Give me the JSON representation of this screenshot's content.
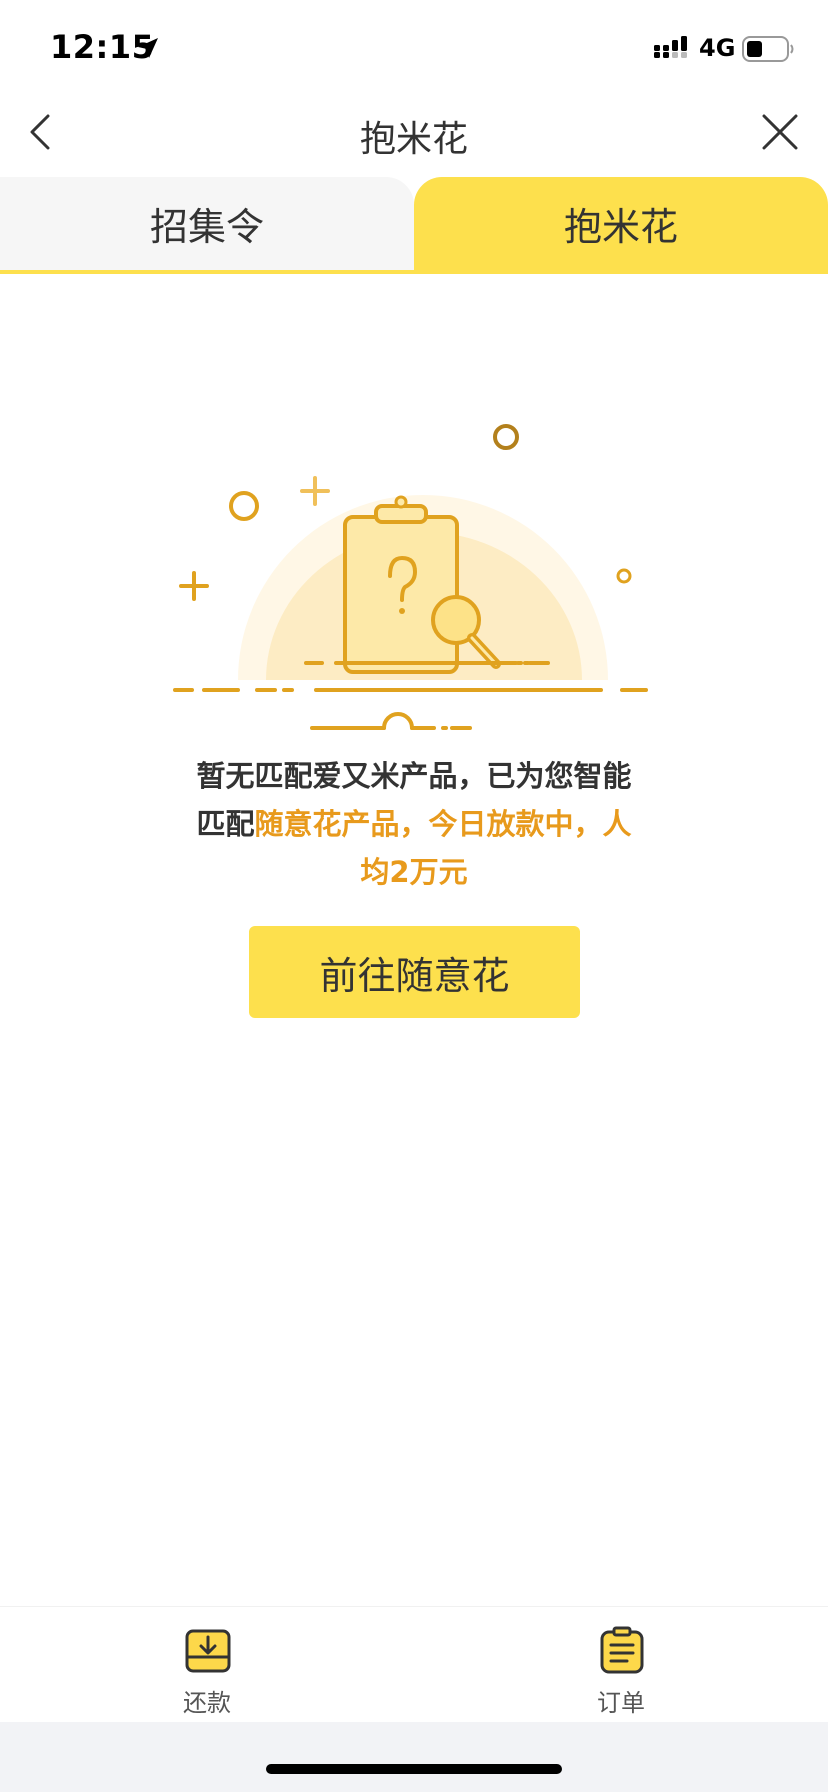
{
  "status": {
    "time": "12:15",
    "network": "4G"
  },
  "nav": {
    "title": "抱米花"
  },
  "tabs": [
    {
      "label": "招集令",
      "active": false
    },
    {
      "label": "抱米花",
      "active": true
    }
  ],
  "empty_state": {
    "line1": "暂无匹配爱又米产品，已为您智能",
    "line2_prefix": "匹配",
    "line2_highlight": "随意花产品，今日放款中，人",
    "line3_highlight": "均2万元",
    "highlight_color": "#e89a1c"
  },
  "cta": {
    "label": "前往随意花"
  },
  "bottom_nav": [
    {
      "label": "还款",
      "icon": "repay-icon"
    },
    {
      "label": "订单",
      "icon": "order-icon"
    }
  ],
  "colors": {
    "accent": "#fde04d",
    "illustration": "#e0a21f",
    "text": "#333333"
  }
}
